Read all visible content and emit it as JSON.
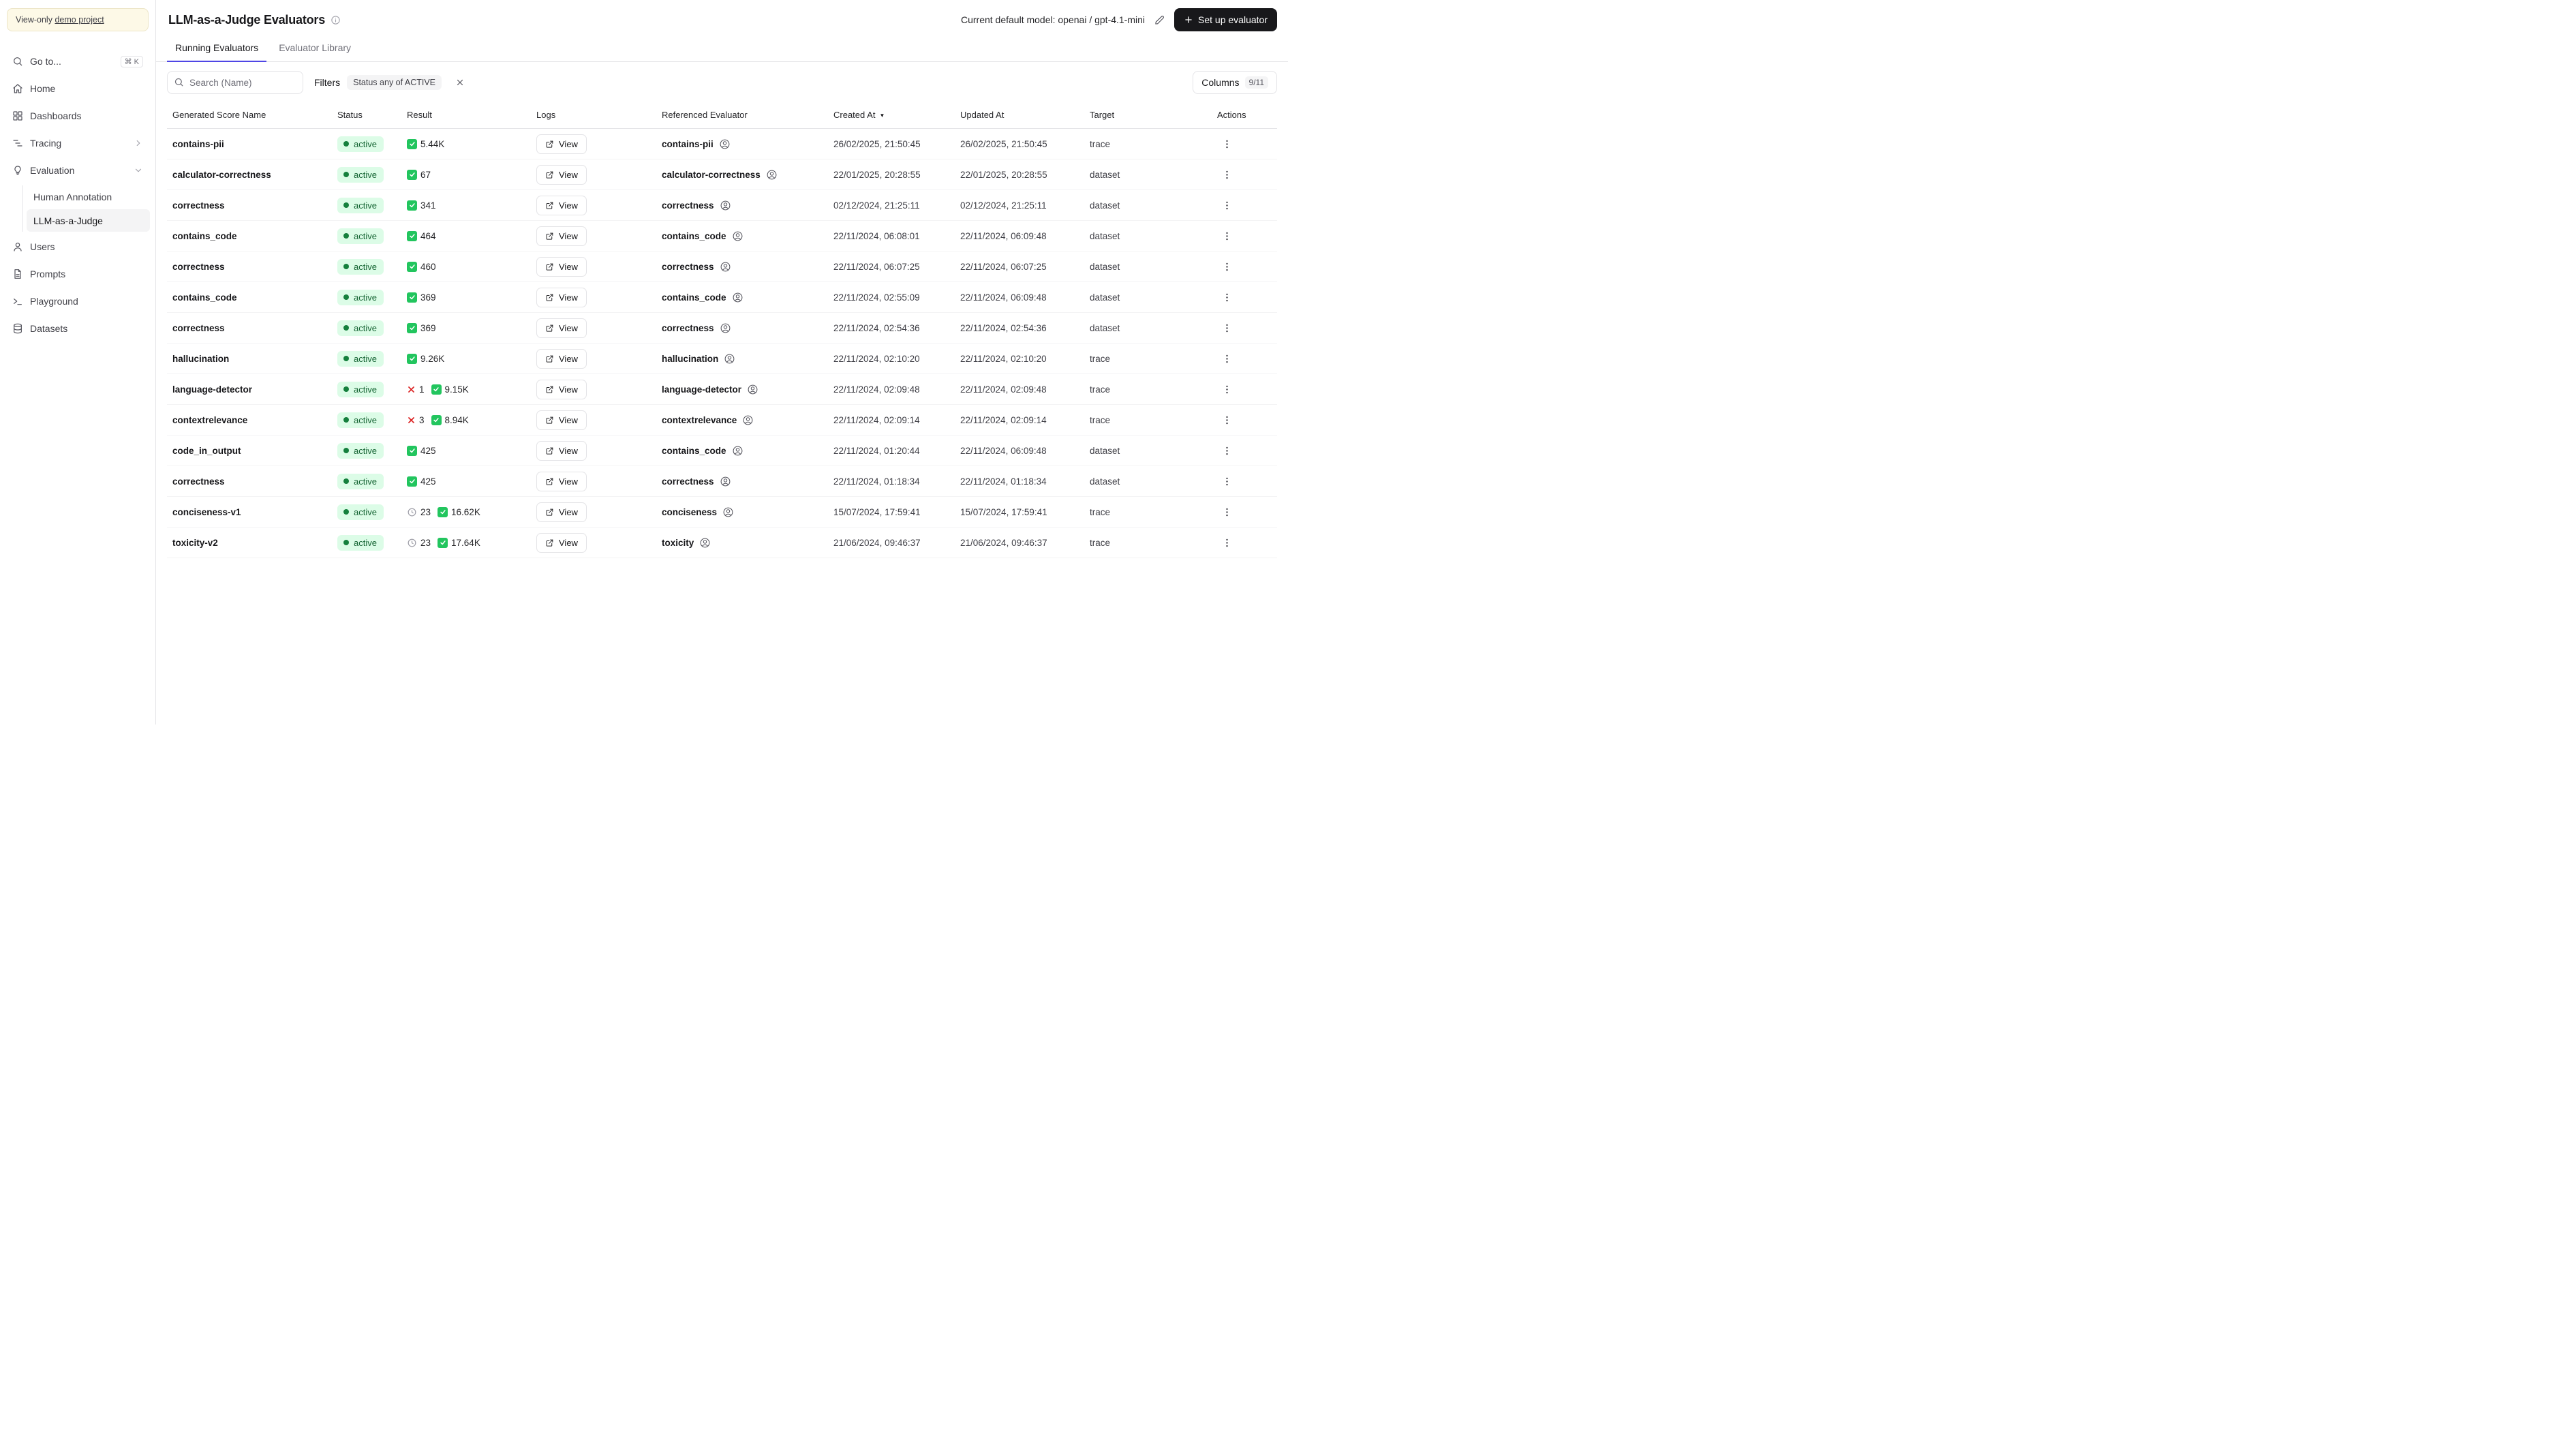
{
  "sidebar": {
    "banner": {
      "prefix": "View-only",
      "link": "demo project"
    },
    "goto": {
      "label": "Go to...",
      "shortcut": "⌘ K"
    },
    "items": {
      "home": "Home",
      "dashboards": "Dashboards",
      "tracing": "Tracing",
      "evaluation": "Evaluation",
      "human_annotation": "Human Annotation",
      "llm_judge": "LLM-as-a-Judge",
      "users": "Users",
      "prompts": "Prompts",
      "playground": "Playground",
      "datasets": "Datasets"
    }
  },
  "header": {
    "title": "LLM-as-a-Judge Evaluators",
    "model_label": "Current default model: openai / gpt-4.1-mini",
    "setup_button": "Set up evaluator"
  },
  "tabs": [
    {
      "label": "Running Evaluators",
      "active": true
    },
    {
      "label": "Evaluator Library",
      "active": false
    }
  ],
  "toolbar": {
    "search_placeholder": "Search (Name)",
    "filters_label": "Filters",
    "filter_chip": "Status any of ACTIVE",
    "columns_label": "Columns",
    "columns_count": "9/11"
  },
  "table": {
    "columns": [
      "Generated Score Name",
      "Status",
      "Result",
      "Logs",
      "Referenced Evaluator",
      "Created At",
      "Updated At",
      "Target",
      "Actions"
    ],
    "sorted_column": "Created At",
    "sort_direction": "desc",
    "view_label": "View",
    "rows": [
      {
        "name": "contains-pii",
        "status": "active",
        "results": [
          {
            "type": "pass",
            "count": "5.44K"
          }
        ],
        "evaluator": "contains-pii",
        "created": "26/02/2025, 21:50:45",
        "updated": "26/02/2025, 21:50:45",
        "target": "trace"
      },
      {
        "name": "calculator-correctness",
        "status": "active",
        "results": [
          {
            "type": "pass",
            "count": "67"
          }
        ],
        "evaluator": "calculator-correctness",
        "created": "22/01/2025, 20:28:55",
        "updated": "22/01/2025, 20:28:55",
        "target": "dataset"
      },
      {
        "name": "correctness",
        "status": "active",
        "results": [
          {
            "type": "pass",
            "count": "341"
          }
        ],
        "evaluator": "correctness",
        "created": "02/12/2024, 21:25:11",
        "updated": "02/12/2024, 21:25:11",
        "target": "dataset"
      },
      {
        "name": "contains_code",
        "status": "active",
        "results": [
          {
            "type": "pass",
            "count": "464"
          }
        ],
        "evaluator": "contains_code",
        "created": "22/11/2024, 06:08:01",
        "updated": "22/11/2024, 06:09:48",
        "target": "dataset"
      },
      {
        "name": "correctness",
        "status": "active",
        "results": [
          {
            "type": "pass",
            "count": "460"
          }
        ],
        "evaluator": "correctness",
        "created": "22/11/2024, 06:07:25",
        "updated": "22/11/2024, 06:07:25",
        "target": "dataset"
      },
      {
        "name": "contains_code",
        "status": "active",
        "results": [
          {
            "type": "pass",
            "count": "369"
          }
        ],
        "evaluator": "contains_code",
        "created": "22/11/2024, 02:55:09",
        "updated": "22/11/2024, 06:09:48",
        "target": "dataset"
      },
      {
        "name": "correctness",
        "status": "active",
        "results": [
          {
            "type": "pass",
            "count": "369"
          }
        ],
        "evaluator": "correctness",
        "created": "22/11/2024, 02:54:36",
        "updated": "22/11/2024, 02:54:36",
        "target": "dataset"
      },
      {
        "name": "hallucination",
        "status": "active",
        "results": [
          {
            "type": "pass",
            "count": "9.26K"
          }
        ],
        "evaluator": "hallucination",
        "created": "22/11/2024, 02:10:20",
        "updated": "22/11/2024, 02:10:20",
        "target": "trace"
      },
      {
        "name": "language-detector",
        "status": "active",
        "results": [
          {
            "type": "fail",
            "count": "1"
          },
          {
            "type": "pass",
            "count": "9.15K"
          }
        ],
        "evaluator": "language-detector",
        "created": "22/11/2024, 02:09:48",
        "updated": "22/11/2024, 02:09:48",
        "target": "trace"
      },
      {
        "name": "contextrelevance",
        "status": "active",
        "results": [
          {
            "type": "fail",
            "count": "3"
          },
          {
            "type": "pass",
            "count": "8.94K"
          }
        ],
        "evaluator": "contextrelevance",
        "created": "22/11/2024, 02:09:14",
        "updated": "22/11/2024, 02:09:14",
        "target": "trace"
      },
      {
        "name": "code_in_output",
        "status": "active",
        "results": [
          {
            "type": "pass",
            "count": "425"
          }
        ],
        "evaluator": "contains_code",
        "created": "22/11/2024, 01:20:44",
        "updated": "22/11/2024, 06:09:48",
        "target": "dataset"
      },
      {
        "name": "correctness",
        "status": "active",
        "results": [
          {
            "type": "pass",
            "count": "425"
          }
        ],
        "evaluator": "correctness",
        "created": "22/11/2024, 01:18:34",
        "updated": "22/11/2024, 01:18:34",
        "target": "dataset"
      },
      {
        "name": "conciseness-v1",
        "status": "active",
        "results": [
          {
            "type": "pending",
            "count": "23"
          },
          {
            "type": "pass",
            "count": "16.62K"
          }
        ],
        "evaluator": "conciseness",
        "created": "15/07/2024, 17:59:41",
        "updated": "15/07/2024, 17:59:41",
        "target": "trace"
      },
      {
        "name": "toxicity-v2",
        "status": "active",
        "results": [
          {
            "type": "pending",
            "count": "23"
          },
          {
            "type": "pass",
            "count": "17.64K"
          }
        ],
        "evaluator": "toxicity",
        "created": "21/06/2024, 09:46:37",
        "updated": "21/06/2024, 09:46:37",
        "target": "trace"
      }
    ]
  }
}
